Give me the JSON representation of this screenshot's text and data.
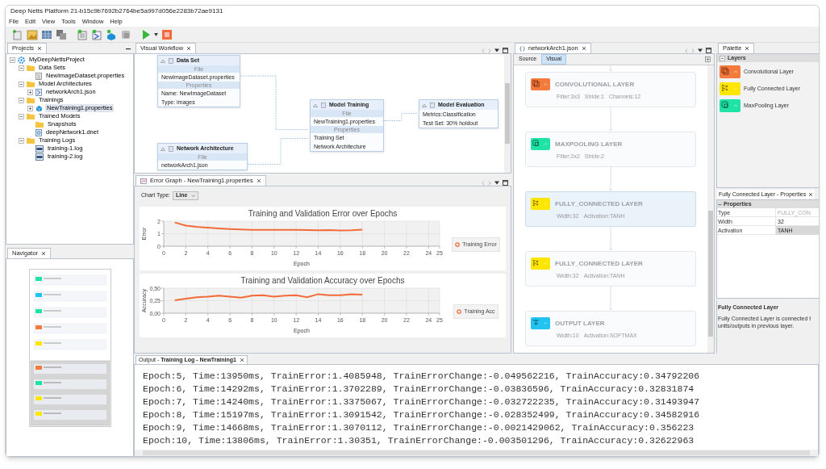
{
  "window": {
    "title": "Deep Netts Platform 21-b15c9b7692b2764be5a997d056e2283b72ae9131"
  },
  "menu": [
    "File",
    "Edit",
    "View",
    "Tools",
    "Window",
    "Help"
  ],
  "projects": {
    "tab": "Projects",
    "tree": [
      {
        "label": "MyDeepNettsProject",
        "kind": "project",
        "expanded": true,
        "selected": false,
        "children": [
          {
            "label": "Data Sets",
            "kind": "folder",
            "expanded": true,
            "selected": false,
            "children": [
              {
                "label": "NewImageDataset.properties",
                "kind": "file",
                "selected": false
              }
            ]
          },
          {
            "label": "Model Architectures",
            "kind": "folder",
            "expanded": true,
            "selected": false,
            "children": [
              {
                "label": "networkArch1.json",
                "kind": "architecture",
                "expanded": false,
                "selected": false
              }
            ]
          },
          {
            "label": "Trainings",
            "kind": "folder",
            "expanded": true,
            "selected": false,
            "children": [
              {
                "label": "NewTraining1.properties",
                "kind": "training",
                "expanded": false,
                "selected": true
              }
            ]
          },
          {
            "label": "Trained Models",
            "kind": "folder",
            "expanded": true,
            "selected": false,
            "children": [
              {
                "label": "Snapshots",
                "kind": "folder",
                "selected": false
              },
              {
                "label": "deepNetwork1.dnet",
                "kind": "model",
                "selected": false
              }
            ]
          },
          {
            "label": "Training Logs",
            "kind": "folder",
            "expanded": true,
            "selected": false,
            "children": [
              {
                "label": "training-1.log",
                "kind": "log",
                "selected": false
              },
              {
                "label": "training-2.log",
                "kind": "log",
                "selected": false
              }
            ]
          }
        ]
      }
    ]
  },
  "navigator": {
    "tab": "Navigator"
  },
  "workflow": {
    "tab": "Visual Workflow",
    "nodes": [
      {
        "title": "Data Set",
        "sections": [
          {
            "header": "File",
            "rows": [
              "NewImageDataset.properties"
            ]
          },
          {
            "header": "Properties",
            "rows": [
              "Name: NewImageDataset",
              "Type: images"
            ]
          }
        ]
      },
      {
        "title": "Network Architecture",
        "sections": [
          {
            "header": "File",
            "rows": [
              "networkArch1.json"
            ]
          }
        ]
      },
      {
        "title": "Model Training",
        "sections": [
          {
            "header": "File",
            "rows": [
              "NewTraining1.properties"
            ]
          },
          {
            "header": "Properties",
            "rows": [
              "Training Set",
              "Network Architecture"
            ]
          }
        ]
      },
      {
        "title": "Model Evaluation",
        "sections": [
          {
            "rows": [
              "Metrics:Classification",
              "Test Set: 30% holdout"
            ]
          }
        ]
      }
    ]
  },
  "error_graph": {
    "tab": "Error Graph - NewTraining1.properties",
    "chart_type_label": "Chart Type:",
    "chart_type": "Line",
    "charts": [
      {
        "chart_data": {
          "type": "line",
          "title": "Training and Validation Error over Epochs",
          "xlabel": "Epoch",
          "ylabel": "Error",
          "x": [
            1,
            2,
            3,
            4,
            5,
            6,
            7,
            8,
            9,
            10,
            11,
            12,
            13,
            14,
            15,
            16,
            17,
            18
          ],
          "xlim": [
            0,
            25
          ],
          "ylim": [
            0,
            2
          ],
          "xticks": [
            0,
            2,
            4,
            6,
            8,
            10,
            12,
            14,
            16,
            18,
            20,
            22,
            24,
            25
          ],
          "yticks": [
            0,
            1,
            2
          ],
          "grid": true,
          "series": [
            {
              "name": "Training Error",
              "color": "#f26b38",
              "values": [
                1.9,
                1.65,
                1.55,
                1.48,
                1.41,
                1.37,
                1.34,
                1.31,
                1.31,
                1.3,
                1.3,
                1.3,
                1.29,
                1.28,
                1.29,
                1.25,
                1.27,
                1.32
              ]
            }
          ]
        }
      },
      {
        "chart_data": {
          "type": "line",
          "title": "Training and Validation Accuracy over Epochs",
          "xlabel": "Epoch",
          "ylabel": "Accuracy",
          "x": [
            1,
            2,
            3,
            4,
            5,
            6,
            7,
            8,
            9,
            10,
            11,
            12,
            13,
            14,
            15,
            16,
            17,
            18
          ],
          "xlim": [
            0,
            25
          ],
          "ylim": [
            0,
            0.5
          ],
          "xticks": [
            0,
            2,
            4,
            6,
            8,
            10,
            12,
            14,
            16,
            18,
            20,
            22,
            24,
            25
          ],
          "yticks": [
            {
              "value": 0,
              "label": "0,00"
            },
            {
              "value": 0.25,
              "label": "0,25"
            },
            {
              "value": 0.5,
              "label": "0,50"
            }
          ],
          "grid": true,
          "series": [
            {
              "name": "Training Acc",
              "color": "#f26b38",
              "values": [
                0.26,
                0.29,
                0.32,
                0.33,
                0.35,
                0.33,
                0.31,
                0.35,
                0.36,
                0.33,
                0.35,
                0.36,
                0.32,
                0.38,
                0.36,
                0.36,
                0.38,
                0.37
              ]
            }
          ]
        }
      }
    ]
  },
  "network_editor": {
    "tab": "networkArch1.json",
    "views": [
      {
        "label": "Source",
        "selected": false
      },
      {
        "label": "Visual",
        "selected": true
      }
    ],
    "layers": [
      {
        "title": "CONVOLUTIONAL LAYER",
        "kind": "convolutional",
        "params": [
          "Filter:3x3",
          "Stride:1",
          "Channels:12"
        ],
        "selected": false
      },
      {
        "title": "MAXPOOLING LAYER",
        "kind": "maxpooling",
        "params": [
          "Filter:2x2",
          "Stride:2"
        ],
        "selected": false
      },
      {
        "title": "FULLY_CONNECTED LAYER",
        "kind": "fully_connected",
        "params": [
          "Width:32",
          "Activation:TANH"
        ],
        "selected": true
      },
      {
        "title": "FULLY_CONNECTED LAYER",
        "kind": "fully_connected",
        "params": [
          "Width:32",
          "Activation:TANH"
        ],
        "selected": false
      },
      {
        "title": "OUTPUT LAYER",
        "kind": "output",
        "params": [
          "Width:10",
          "Activation:SOFTMAX"
        ],
        "selected": false
      }
    ]
  },
  "palette": {
    "tab": "Palette",
    "category": "Layers",
    "items": [
      {
        "label": "Convolutional Layer",
        "kind": "convolutional"
      },
      {
        "label": "Fully Connected Layer",
        "kind": "fully_connected"
      },
      {
        "label": "MaxPooling Layer",
        "kind": "maxpooling"
      }
    ]
  },
  "properties": {
    "tab": "Fully Connected Layer - Properties",
    "section": "Properties",
    "rows": [
      {
        "name": "Type",
        "value": "FULLY_CON",
        "disabled": true,
        "selected": false
      },
      {
        "name": "Width",
        "value": "32",
        "disabled": false,
        "selected": false
      },
      {
        "name": "Activation",
        "value": "TANH",
        "disabled": false,
        "selected": true
      }
    ]
  },
  "description": {
    "title": "Fully Connected Layer",
    "lines": [
      "Fully Connected Layer is connected t",
      "units/outputs in previous layer."
    ]
  },
  "output": {
    "tab": "Output - **Training Log - NewTraining1**",
    "lines": [
      "Epoch:5, Time:13950ms, TrainError:1.4085948, TrainErrorChange:-0.049562216, TrainAccuracy:0.34792206",
      "Epoch:6, Time:14292ms, TrainError:1.3702289, TrainErrorChange:-0.03836596, TrainAccuracy:0.32831874",
      "Epoch:7, Time:14240ms, TrainError:1.3375067, TrainErrorChange:-0.032722235, TrainAccuracy:0.31493947",
      "Epoch:8, Time:15197ms, TrainError:1.3091542, TrainErrorChange:-0.028352499, TrainAccuracy:0.34582916",
      "Epoch:9, Time:14668ms, TrainError:1.3070112, TrainErrorChange:-0.0021429062, TrainAccuracy:0.356223",
      "Epoch:10, Time:13806ms, TrainError:1.30351, TrainErrorChange:-0.003501296, TrainAccuracy:0.32622963"
    ]
  }
}
